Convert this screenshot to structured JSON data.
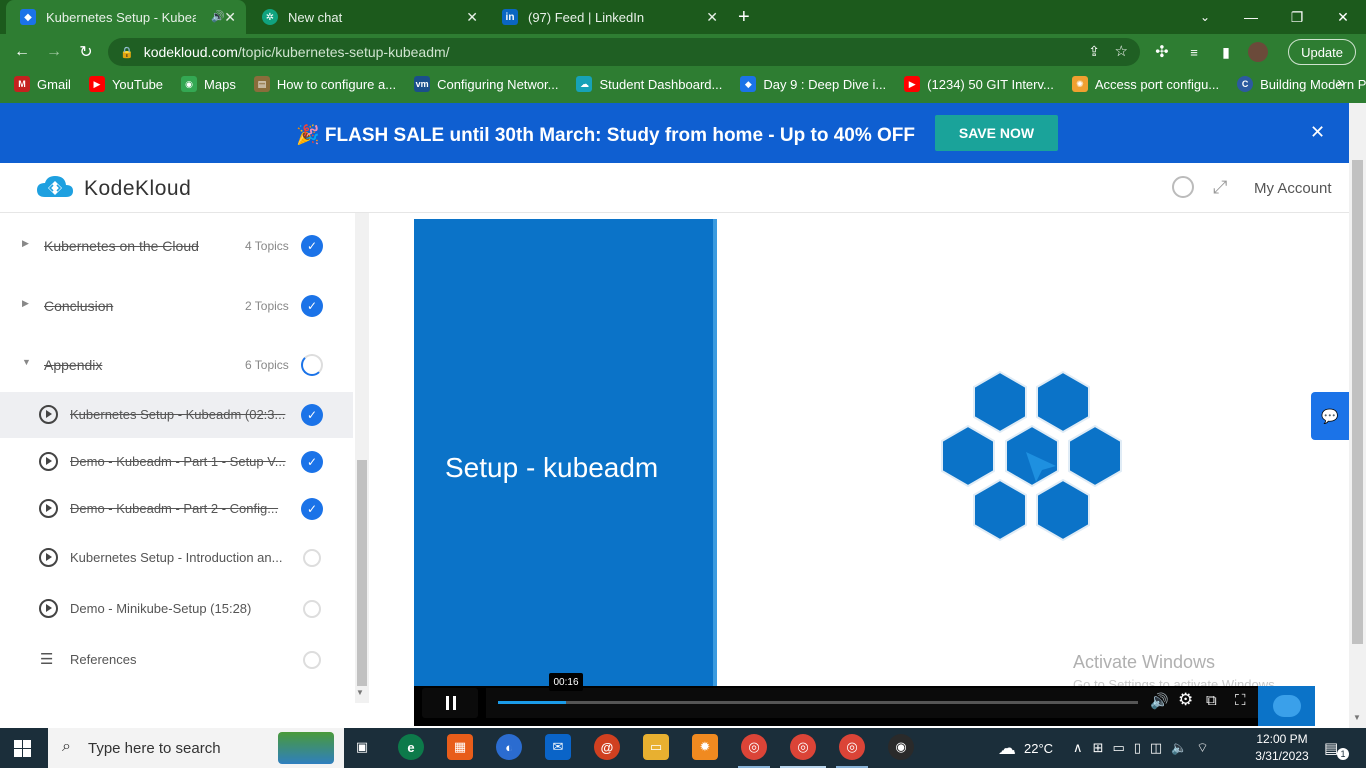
{
  "browser": {
    "tabs": [
      {
        "title": "Kubernetes Setup - Kubeadm",
        "favicon": "kodekloud-icon",
        "active": true
      },
      {
        "title": "New chat",
        "favicon": "chatgpt-icon",
        "active": false
      },
      {
        "title": "(97) Feed | LinkedIn",
        "favicon": "linkedin-icon",
        "active": false
      }
    ],
    "new_tab_label": "+",
    "url_host": "kodekloud.com",
    "url_path": "/topic/kubernetes-setup-kubeadm/",
    "update_label": "Update",
    "bookmarks": [
      {
        "label": "Gmail",
        "icon": "gmail-icon",
        "color": "#c5221f"
      },
      {
        "label": "YouTube",
        "icon": "youtube-icon",
        "color": "#ff0000"
      },
      {
        "label": "Maps",
        "icon": "maps-icon",
        "color": "#34a853"
      },
      {
        "label": "How to configure a...",
        "icon": "page-icon",
        "color": "#8a6d3b"
      },
      {
        "label": "Configuring Networ...",
        "icon": "vmware-icon",
        "color": "#1a4f8b"
      },
      {
        "label": "Student Dashboard...",
        "icon": "cloud-icon",
        "color": "#17a2b8"
      },
      {
        "label": "Day 9 : Deep Dive i...",
        "icon": "diamond-icon",
        "color": "#1b73e8"
      },
      {
        "label": "(1234) 50 GIT Interv...",
        "icon": "youtube-icon",
        "color": "#ff0000"
      },
      {
        "label": "Access port configu...",
        "icon": "swirl-icon",
        "color": "#f0a030"
      },
      {
        "label": "Building Modern Py...",
        "icon": "c-icon",
        "color": "#2c5aa0"
      }
    ],
    "bookmarks_more": "»"
  },
  "banner": {
    "text": "🎉 FLASH SALE until 30th March: Study from home - Up to 40% OFF",
    "cta": "SAVE NOW",
    "close": "✕"
  },
  "site": {
    "logo_text": "KodeKloud",
    "account_label": "My Account"
  },
  "sidebar": {
    "sections": [
      {
        "name": "Kubernetes on the Cloud",
        "count": "4 Topics",
        "status": "complete",
        "expanded": false
      },
      {
        "name": "Conclusion",
        "count": "2 Topics",
        "status": "complete",
        "expanded": false
      },
      {
        "name": "Appendix",
        "count": "6 Topics",
        "status": "in-progress",
        "expanded": true
      }
    ],
    "topics": [
      {
        "name": "Kubernetes Setup - Kubeadm (02:3...",
        "status": "complete",
        "current": true,
        "kind": "video"
      },
      {
        "name": "Demo - Kubeadm - Part 1 - Setup V...",
        "status": "complete",
        "current": false,
        "kind": "video"
      },
      {
        "name": "Demo - Kubeadm - Part 2 - Config...",
        "status": "complete",
        "current": false,
        "kind": "video"
      },
      {
        "name": "Kubernetes Setup - Introduction an...",
        "status": "incomplete",
        "current": false,
        "kind": "video"
      },
      {
        "name": "Demo - Minikube-Setup (15:28)",
        "status": "incomplete",
        "current": false,
        "kind": "video"
      },
      {
        "name": "References",
        "status": "incomplete",
        "current": false,
        "kind": "list"
      }
    ]
  },
  "video": {
    "slide_title": "Setup - kubeadm",
    "current_time": "00:16",
    "progress_fraction": 0.106,
    "watermark_line1": "Activate Windows",
    "watermark_line2": "Go to Settings to activate Windows."
  },
  "taskbar": {
    "search_placeholder": "Type here to search",
    "weather": "22°C",
    "time": "12:00 PM",
    "date": "3/31/2023",
    "notification_count": "1"
  },
  "colors": {
    "chrome_green": "#2e7d32",
    "banner_blue": "#0f5fd1",
    "cta_teal": "#1aa39a",
    "check_blue": "#1b73e8",
    "slide_blue": "#0b73c8"
  }
}
